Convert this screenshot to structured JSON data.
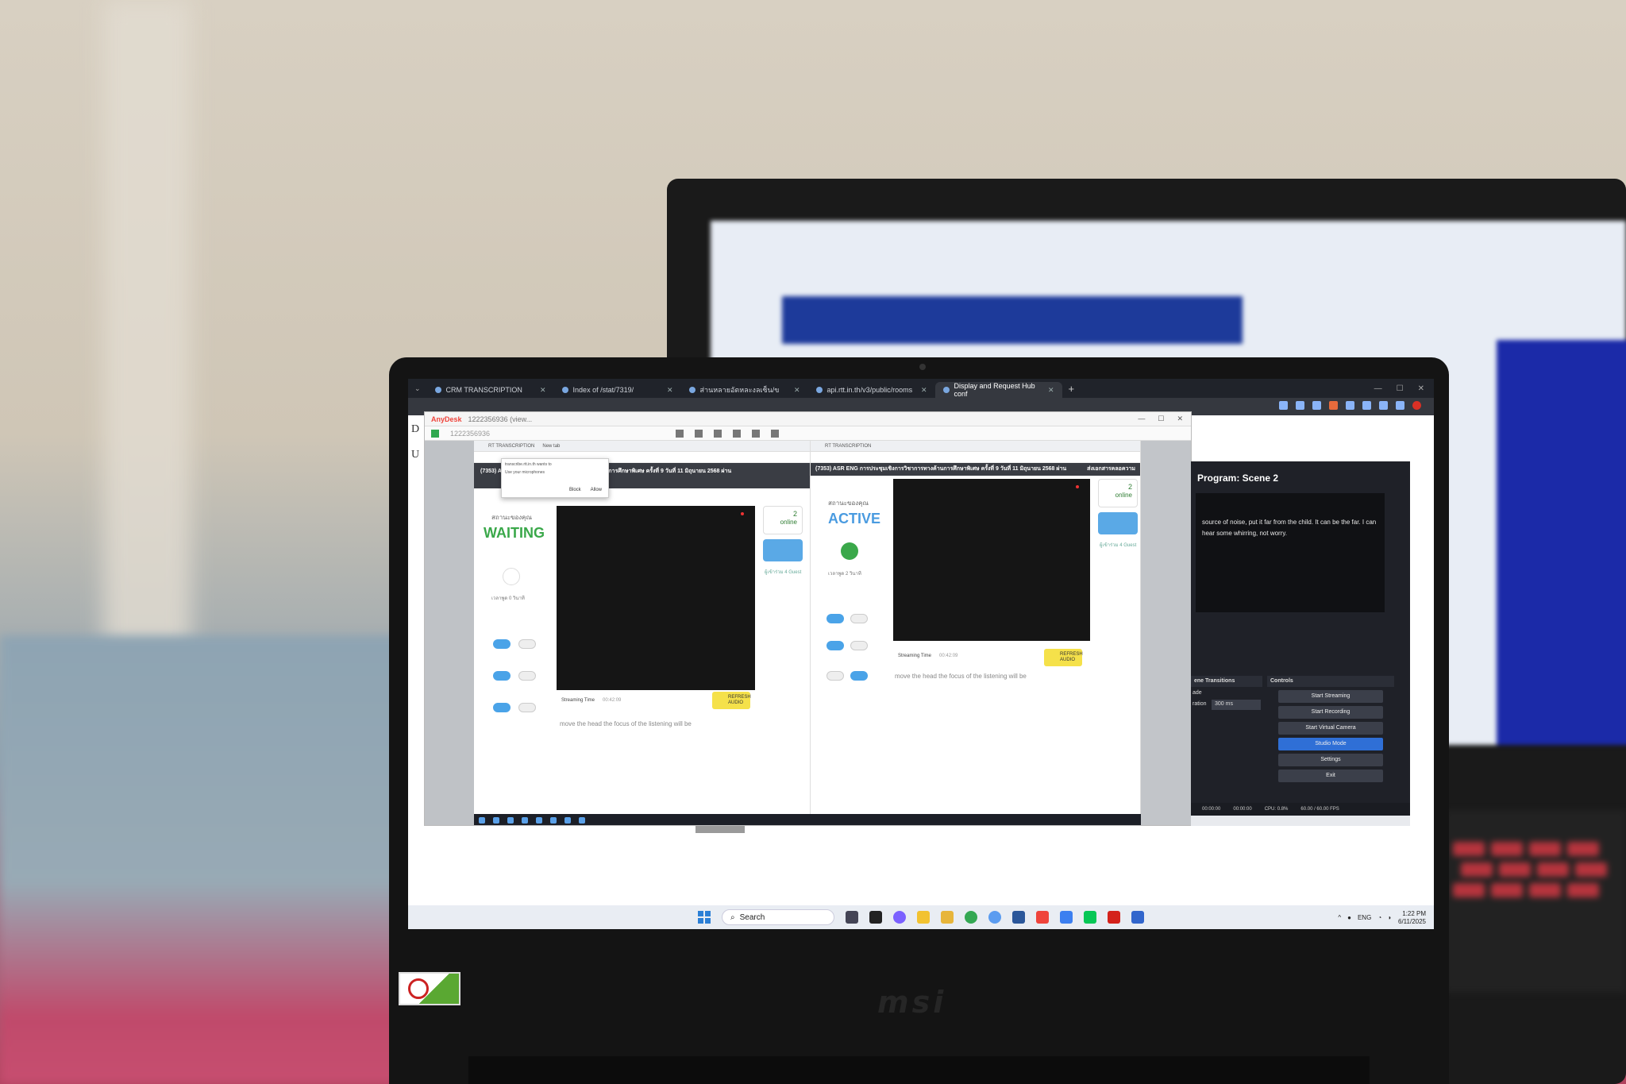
{
  "browser": {
    "tabs": [
      {
        "label": "CRM TRANSCRIPTION",
        "active": false
      },
      {
        "label": "Index of /stat/7319/",
        "active": false
      },
      {
        "label": "ส่านหลายอัตหละงลเซ็น/ขอนเซี่ยม",
        "active": false
      },
      {
        "label": "api.rtt.in.th/v3/public/rooms",
        "active": false
      },
      {
        "label": "Display and Request Hub conf",
        "active": true
      }
    ]
  },
  "anydesk": {
    "brand": "AnyDesk",
    "session_id": "1222356936 (view...",
    "address": "1222356936"
  },
  "left_pane": {
    "tab_label": "RT TRANSCRIPTION",
    "tab2_label": "New tab",
    "header": "(7353) ASR ENG การประชุมเชิงการวิชาการทางค้านการศึกษาพิเศษ ครั้งที่ 9 วันที่ 11 มิถุนายน 2568 ผ่าน",
    "popup_text": "transcribe.rtt.in.th wants to",
    "popup_sub": "Use your microphones",
    "popup_block": "Block",
    "popup_allow": "Allow",
    "status_label": "สถานะของคุณ",
    "status": "WAITING",
    "time_label": "เวลาพูด 0 วินาที",
    "online_count": "2",
    "online_label": "online",
    "guest_label": "ผู้เข้าร่วม 4 Guest",
    "streaming_label": "Streaming Time",
    "streaming_time": "00:42:09",
    "refresh_label": "REFRESH AUDIO",
    "transcript": "move the head the focus of the listening will be"
  },
  "right_pane": {
    "tab_label": "RT TRANSCRIPTION",
    "header": "(7353) ASR ENG การประชุมเชิงการวิชาการทางค้านการศึกษาพิเศษ ครั้งที่ 9 วันที่ 11 มิถุนายน 2568 ผ่าน",
    "header_right": "ส่งเอกสารคลอความ",
    "status_label": "สถานะของคุณ",
    "status": "ACTIVE",
    "time_label": "เวลาพูด 2 วินาที",
    "online_count": "2",
    "online_label": "online",
    "guest_label": "ผู้เข้าร่วม 4 Guest",
    "streaming_label": "Streaming Time",
    "streaming_time": "00:42:09",
    "refresh_label": "REFRESH AUDIO",
    "transcript": "move the head the focus of the listening will be"
  },
  "obs": {
    "program_title": "Program: Scene 2",
    "preview_text": "source of noise, put it far from the child. It can be the far. I can hear some whirring, not worry.",
    "transitions_header": "ene Transitions",
    "controls_header": "Controls",
    "fade_label": "ade",
    "duration_label": "ration",
    "duration_value": "300 ms",
    "buttons": [
      "Start Streaming",
      "Start Recording",
      "Start Virtual Camera",
      "Studio Mode",
      "Settings",
      "Exit"
    ],
    "status_time1": "00:00:00",
    "status_time2": "00:00:00",
    "cpu": "CPU: 0.8%",
    "fps": "60.00 / 60.00 FPS"
  },
  "taskbar": {
    "search_placeholder": "Search",
    "lang": "ENG",
    "time": "1:22 PM",
    "date": "6/11/2025"
  },
  "laptop": {
    "brand": "msi"
  }
}
